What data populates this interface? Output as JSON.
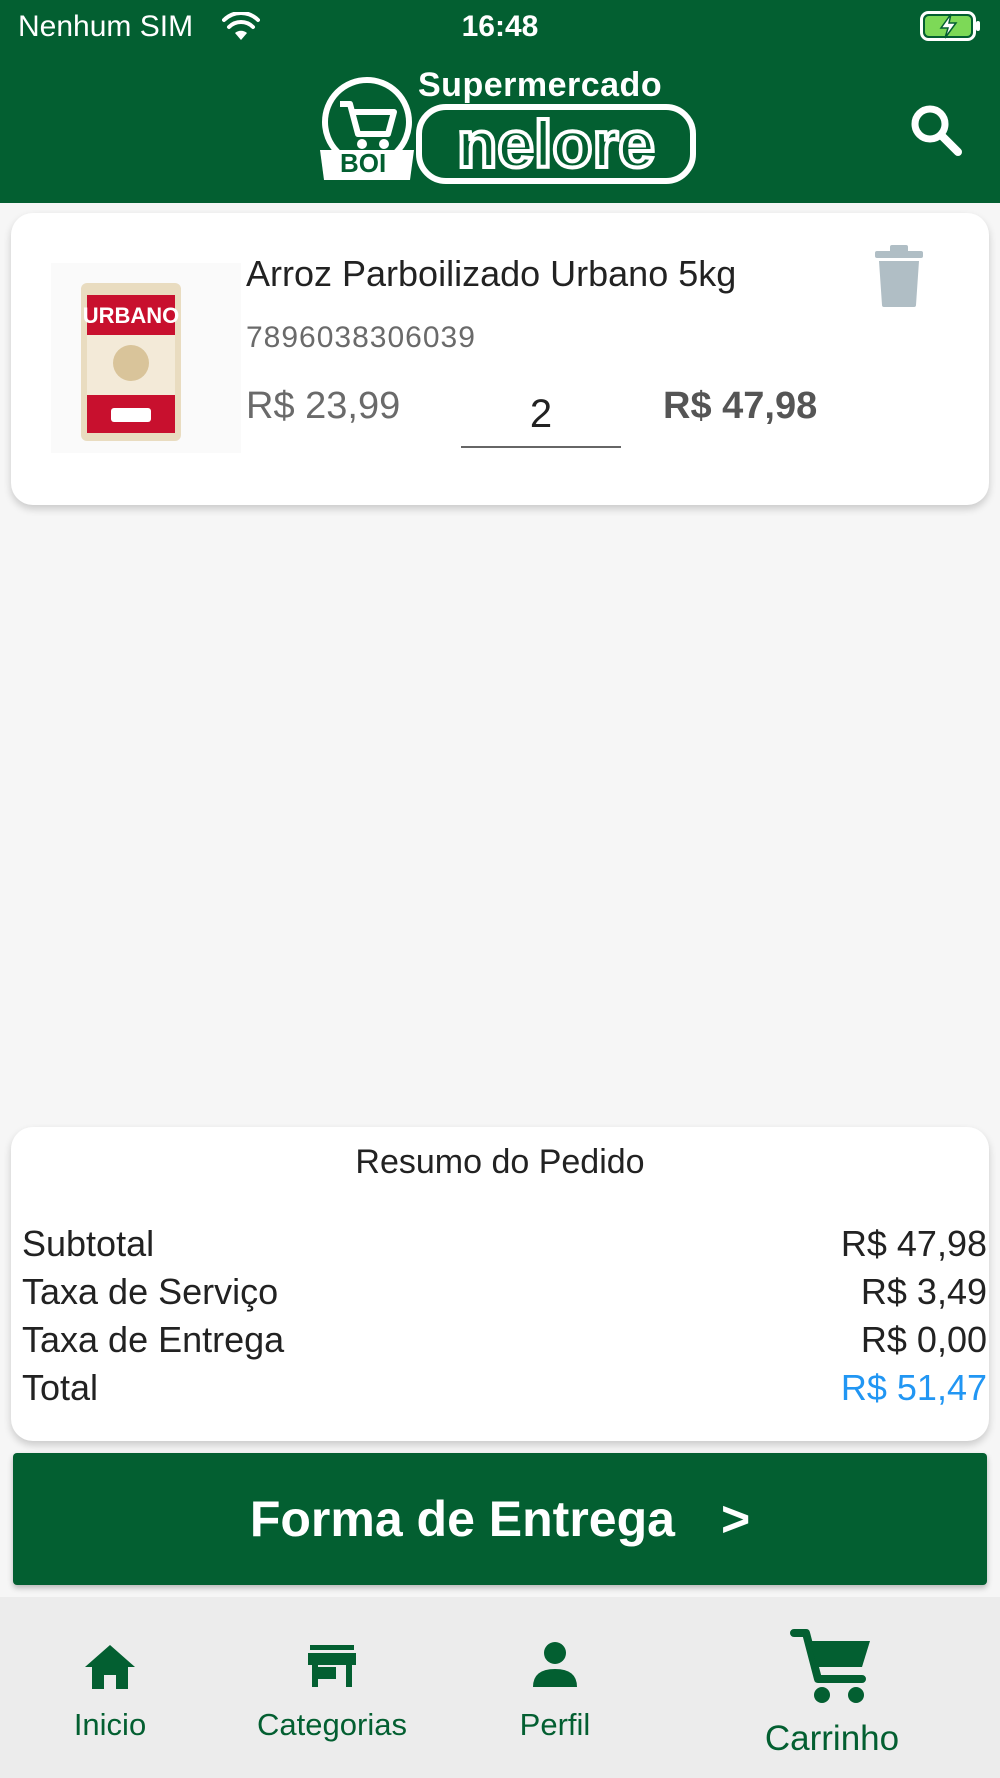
{
  "status_bar": {
    "carrier": "Nenhum SIM",
    "time": "16:48"
  },
  "header": {
    "logo_top": "Supermercado",
    "logo_word": "nelore",
    "logo_badge": "BOI"
  },
  "cart_item": {
    "name": "Arroz Parboilizado Urbano 5kg",
    "code": "7896038306039",
    "unit_price": "R$ 23,99",
    "quantity": "2",
    "line_total": "R$ 47,98",
    "image_brand": "URBANO"
  },
  "summary": {
    "title": "Resumo do Pedido",
    "rows": [
      {
        "label": "Subtotal",
        "value": "R$ 47,98"
      },
      {
        "label": "Taxa de Serviço",
        "value": "R$ 3,49"
      },
      {
        "label": "Taxa de Entrega",
        "value": "R$ 0,00"
      },
      {
        "label": "Total",
        "value": "R$ 51,47"
      }
    ]
  },
  "delivery_button": {
    "label": "Forma de Entrega",
    "chevron": ">"
  },
  "bottom_nav": {
    "items": [
      {
        "label": "Inicio",
        "icon": "home-icon"
      },
      {
        "label": "Categorias",
        "icon": "store-icon"
      },
      {
        "label": "Perfil",
        "icon": "person-icon"
      },
      {
        "label": "Carrinho",
        "icon": "cart-icon"
      }
    ]
  },
  "colors": {
    "primary": "#035f31",
    "accent": "#2196f3",
    "nav_bg": "#ececec",
    "trash": "#b0bec5"
  }
}
